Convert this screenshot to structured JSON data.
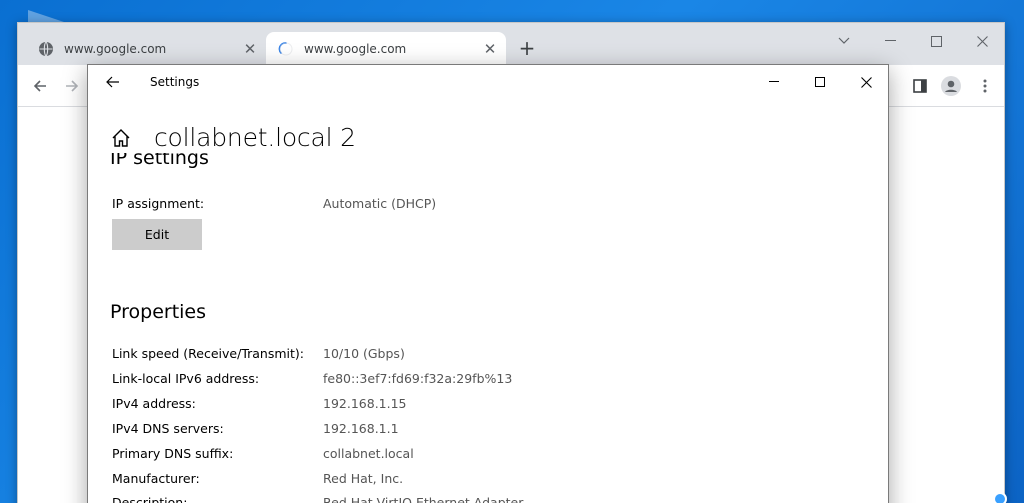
{
  "browser": {
    "tabs": [
      {
        "title": "www.google.com",
        "favicon": "globe-icon",
        "state": "inactive"
      },
      {
        "title": "www.google.com",
        "favicon": "loading-spinner-icon",
        "state": "active"
      }
    ],
    "newtab_symbol": "+",
    "close_symbol": "✕"
  },
  "settings": {
    "window_title": "Settings",
    "page_title": "collabnet.local 2",
    "ip_section_title": "IP settings",
    "ip_assignment": {
      "label": "IP assignment:",
      "value": "Automatic (DHCP)"
    },
    "edit_label": "Edit",
    "properties_title": "Properties",
    "properties": [
      {
        "label": "Link speed (Receive/Transmit):",
        "value": "10/10 (Gbps)"
      },
      {
        "label": "Link-local IPv6 address:",
        "value": "fe80::3ef7:fd69:f32a:29fb%13"
      },
      {
        "label": "IPv4 address:",
        "value": "192.168.1.15"
      },
      {
        "label": "IPv4 DNS servers:",
        "value": "192.168.1.1"
      },
      {
        "label": "Primary DNS suffix:",
        "value": "collabnet.local"
      },
      {
        "label": "Manufacturer:",
        "value": "Red Hat, Inc."
      }
    ],
    "partial_row": {
      "label": "Description:",
      "value": "Red Hat VirtIO Ethernet Adapter"
    }
  }
}
